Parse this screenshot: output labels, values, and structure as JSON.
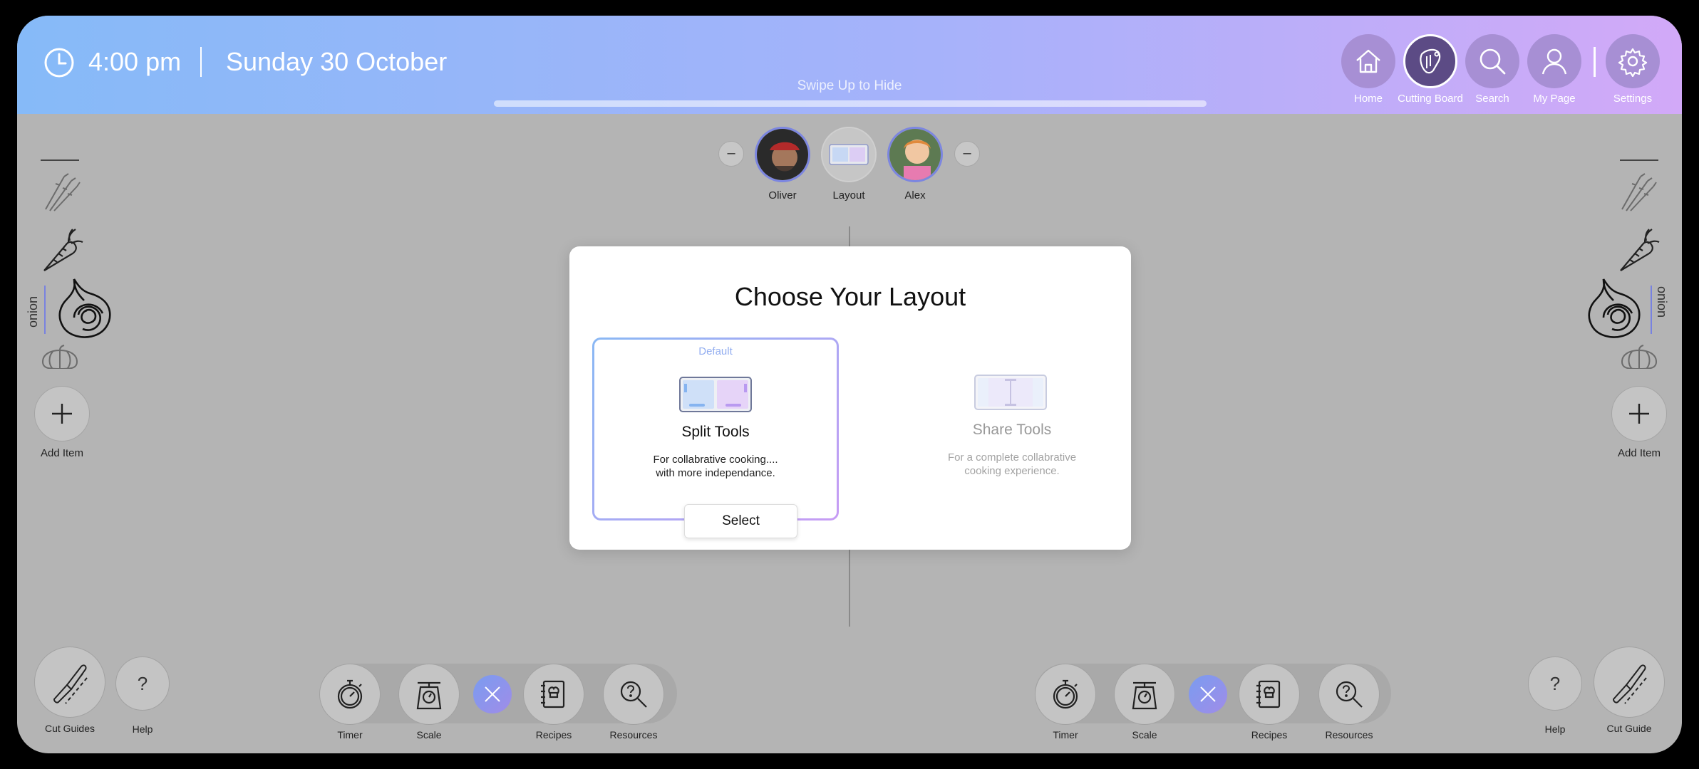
{
  "header": {
    "time": "4:00 pm",
    "date": "Sunday 30 October",
    "swipe_hint": "Swipe Up to Hide",
    "nav": [
      {
        "label": "Home",
        "icon": "home-icon"
      },
      {
        "label": "Cutting Board",
        "icon": "cutting-board-icon",
        "active": true
      },
      {
        "label": "Search",
        "icon": "search-icon"
      },
      {
        "label": "My Page",
        "icon": "user-icon"
      },
      {
        "label": "Settings",
        "icon": "gear-icon"
      }
    ]
  },
  "participants": [
    {
      "name": "Oliver"
    },
    {
      "name": "Layout"
    },
    {
      "name": "Alex"
    }
  ],
  "left_panel": {
    "items": [
      "asparagus-icon",
      "carrot-icon",
      "onion-icon",
      "pumpkin-icon"
    ],
    "selected_label": "onion",
    "add_label": "Add Item"
  },
  "right_panel": {
    "items": [
      "asparagus-icon",
      "carrot-icon",
      "onion-icon",
      "pumpkin-icon"
    ],
    "selected_label": "onion",
    "add_label": "Add Item"
  },
  "bottom_left": {
    "cut_label": "Cut Guides",
    "help_label": "Help",
    "help_glyph": "?",
    "tools": [
      "Timer",
      "Scale",
      "Recipes",
      "Resources"
    ]
  },
  "bottom_right": {
    "cut_label": "Cut Guide",
    "help_label": "Help",
    "help_glyph": "?",
    "tools": [
      "Timer",
      "Scale",
      "Recipes",
      "Resources"
    ]
  },
  "modal": {
    "title": "Choose Your Layout",
    "options": [
      {
        "badge": "Default",
        "name": "Split Tools",
        "desc_line1": "For collabrative cooking....",
        "desc_line2": "with more independance.",
        "selected": true
      },
      {
        "name": "Share Tools",
        "desc_line1": "For a complete collabrative",
        "desc_line2": "cooking experience.",
        "selected": false
      }
    ],
    "select_label": "Select"
  },
  "colors": {
    "header_start": "#86baf8",
    "header_end": "#d2a9f8",
    "nav_button": "#a78fd4",
    "nav_active": "#5c4b85",
    "accent_blue": "#7882e0",
    "background": "#b4b4b4"
  }
}
